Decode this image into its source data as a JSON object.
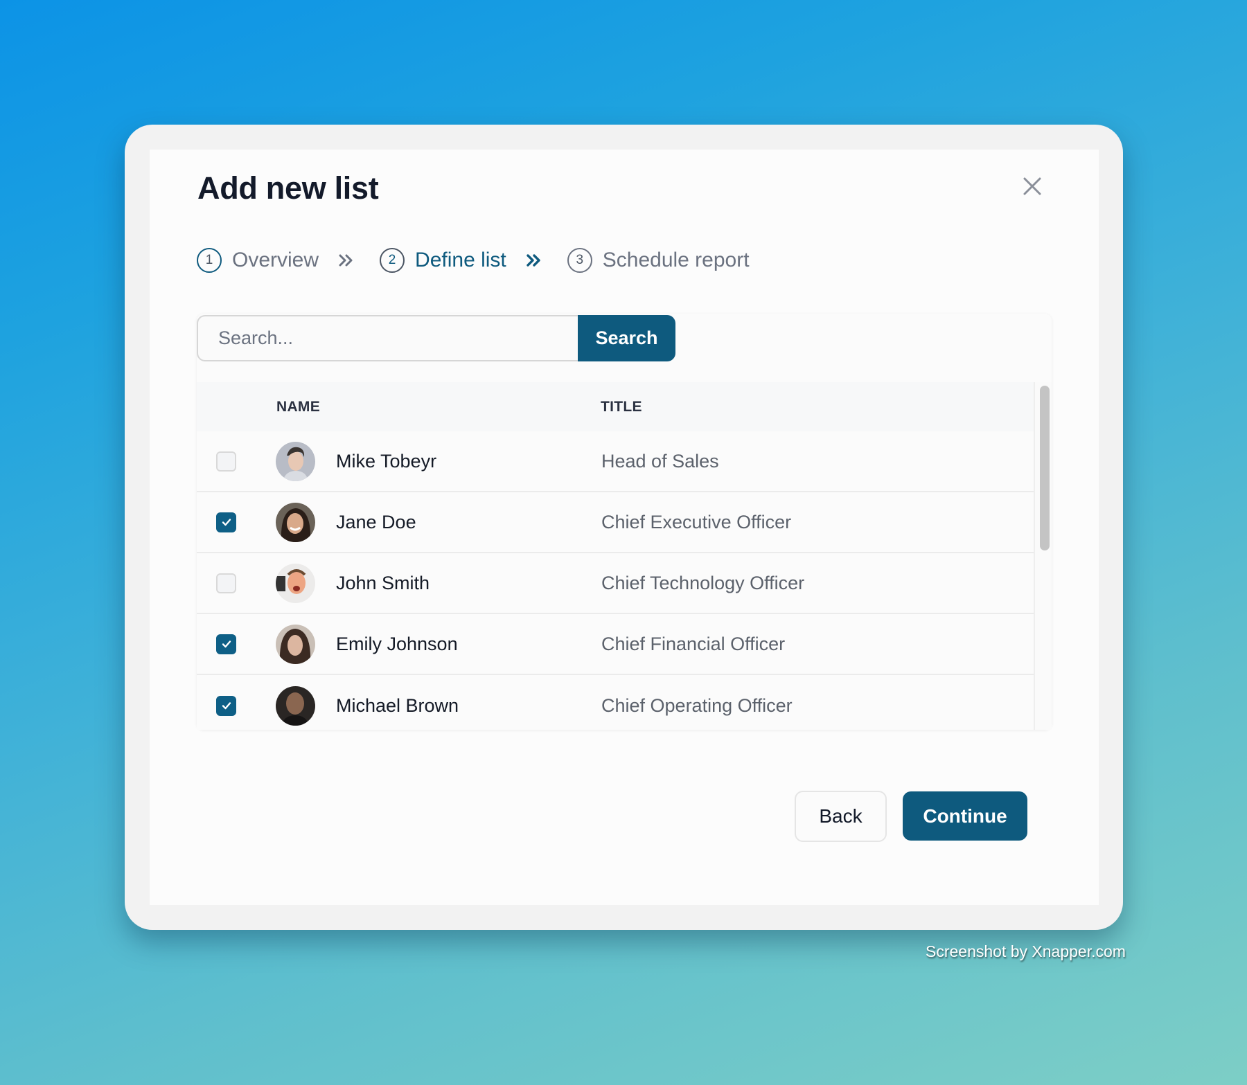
{
  "dialog": {
    "title": "Add new list",
    "close_icon": "close-icon"
  },
  "steps": [
    {
      "number": "1",
      "label": "Overview",
      "state": "done"
    },
    {
      "number": "2",
      "label": "Define list",
      "state": "active"
    },
    {
      "number": "3",
      "label": "Schedule report",
      "state": "upcoming"
    }
  ],
  "step_separator_icon": "double-chevron-right-icon",
  "search": {
    "placeholder": "Search...",
    "value": "",
    "button_label": "Search"
  },
  "table": {
    "columns": [
      "NAME",
      "TITLE"
    ],
    "rows": [
      {
        "name": "Mike Tobeyr",
        "title": "Head of Sales",
        "checked": false
      },
      {
        "name": "Jane Doe",
        "title": "Chief Executive Officer",
        "checked": true
      },
      {
        "name": "John Smith",
        "title": "Chief Technology Officer",
        "checked": false
      },
      {
        "name": "Emily Johnson",
        "title": "Chief Financial Officer",
        "checked": true
      },
      {
        "name": "Michael Brown",
        "title": "Chief Operating Officer",
        "checked": true
      }
    ]
  },
  "footer": {
    "back_label": "Back",
    "continue_label": "Continue"
  },
  "watermark": "Screenshot by Xnapper.com",
  "colors": {
    "accent": "#0e5a7e",
    "checkbox_checked": "#0e5f86",
    "title_text": "#131a2a",
    "muted_text": "#6b7280"
  }
}
